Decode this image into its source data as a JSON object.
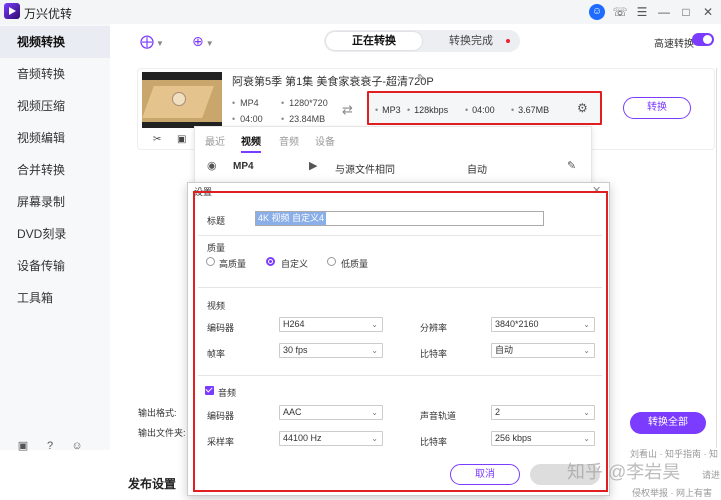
{
  "app": {
    "title": "万兴优转"
  },
  "sidebar": {
    "items": [
      {
        "label": "视频转换",
        "active": true
      },
      {
        "label": "音频转换"
      },
      {
        "label": "视频压缩"
      },
      {
        "label": "视频编辑"
      },
      {
        "label": "合并转换"
      },
      {
        "label": "屏幕录制"
      },
      {
        "label": "DVD刻录"
      },
      {
        "label": "设备传输"
      },
      {
        "label": "工具箱"
      }
    ]
  },
  "toolbar": {
    "tabs": {
      "converting": "正在转换",
      "completed": "转换完成"
    },
    "high_speed_label": "高速转换",
    "high_speed_on": true
  },
  "file": {
    "title": "阿衰第5季 第1集 美食家衰衰子-超清720P",
    "source": {
      "format": "MP4",
      "resolution": "1280*720",
      "duration": "04:00",
      "size": "23.84MB"
    },
    "output": {
      "format": "MP3",
      "bitrate": "128kbps",
      "duration": "04:00",
      "size": "3.67MB"
    },
    "convert_label": "转换"
  },
  "format_panel": {
    "tabs": [
      "最近",
      "视频",
      "音频",
      "设备"
    ],
    "active_tab": "视频",
    "row": {
      "format": "MP4",
      "quality": "与源文件相同",
      "value": "自动"
    }
  },
  "bottom": {
    "output_format_label": "输出格式:",
    "output_folder_label": "输出文件夹:",
    "convert_all": "转换全部",
    "publish": "发布设置"
  },
  "dialog": {
    "title": "设置",
    "title_label": "标题",
    "title_value": "4K 视频 自定义4",
    "quality_label": "质量",
    "quality_options": [
      "高质量",
      "自定义",
      "低质量"
    ],
    "quality_selected": "自定义",
    "video_section": "视频",
    "video": {
      "encoder_label": "编码器",
      "encoder": "H264",
      "resolution_label": "分辨率",
      "resolution": "3840*2160",
      "framerate_label": "帧率",
      "framerate": "30 fps",
      "bitrate_label": "比特率",
      "bitrate": "自动"
    },
    "audio_section": "音频",
    "audio_enabled": true,
    "audio": {
      "encoder_label": "编码器",
      "encoder": "AAC",
      "channel_label": "声音轨道",
      "channel": "2",
      "samplerate_label": "采样率",
      "samplerate": "44100 Hz",
      "bitrate_label": "比特率",
      "bitrate": "256 kbps"
    },
    "cancel_label": "取消"
  },
  "watermark": "知乎 @李岩昊",
  "background_text": {
    "line1": "刘看山 · 知乎指南 · 知",
    "line2": "侵权举报 · 网上有害",
    "line3": "请进"
  }
}
